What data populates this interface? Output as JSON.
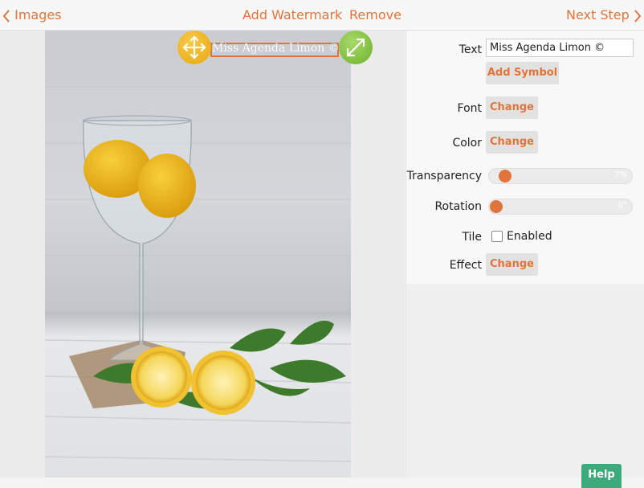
{
  "nav": {
    "back_label": "Images",
    "add_watermark_label": "Add Watermark",
    "remove_label": "Remove",
    "next_label": "Next Step"
  },
  "canvas": {
    "watermark_text": "Miss Agenda Limon ©",
    "move_handle_icon": "move-arrows-icon",
    "resize_handle_icon": "resize-diagonal-icon"
  },
  "panel": {
    "text_label": "Text",
    "text_value": "Miss Agenda Limon ©",
    "add_symbol_label": "Add Symbol",
    "font_label": "Font",
    "font_button": "Change",
    "color_label": "Color",
    "color_button": "Change",
    "transparency_label": "Transparency",
    "transparency_value": "7%",
    "transparency_fraction": 0.07,
    "rotation_label": "Rotation",
    "rotation_value": "0°",
    "rotation_fraction": 0.0,
    "tile_label": "Tile",
    "tile_checkbox_label": "Enabled",
    "tile_enabled": false,
    "effect_label": "Effect",
    "effect_button": "Change"
  },
  "help_label": "Help",
  "colors": {
    "accent": "#e0743a",
    "help": "#3caa7a",
    "move_handle": "#eeb21f",
    "resize_handle": "#7cc23c"
  }
}
